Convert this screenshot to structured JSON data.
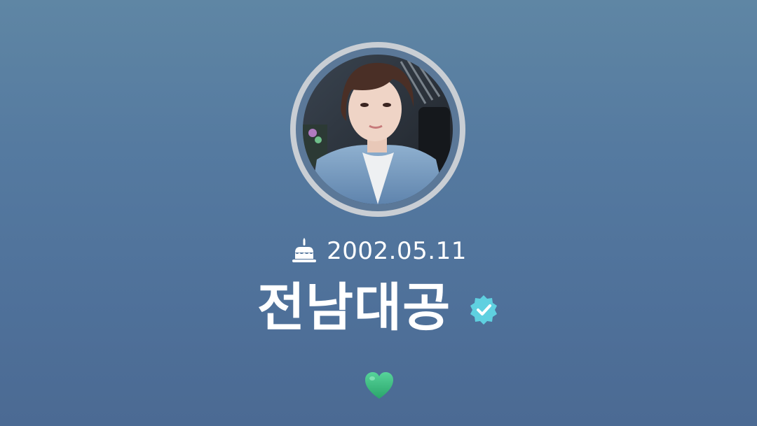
{
  "profile": {
    "avatar_icon": "profile-photo",
    "birthday_icon": "cake-icon",
    "birthday": "2002.05.11",
    "name": "전남대공",
    "verified_icon": "verified-badge-icon",
    "status_icon": "green-heart-icon"
  },
  "colors": {
    "background_top": "#5f86a4",
    "background_bottom": "#4b6a93",
    "avatar_ring": "#c9ced4",
    "verified_badge": "#5fd0e0",
    "heart": "#3fbf7f"
  }
}
